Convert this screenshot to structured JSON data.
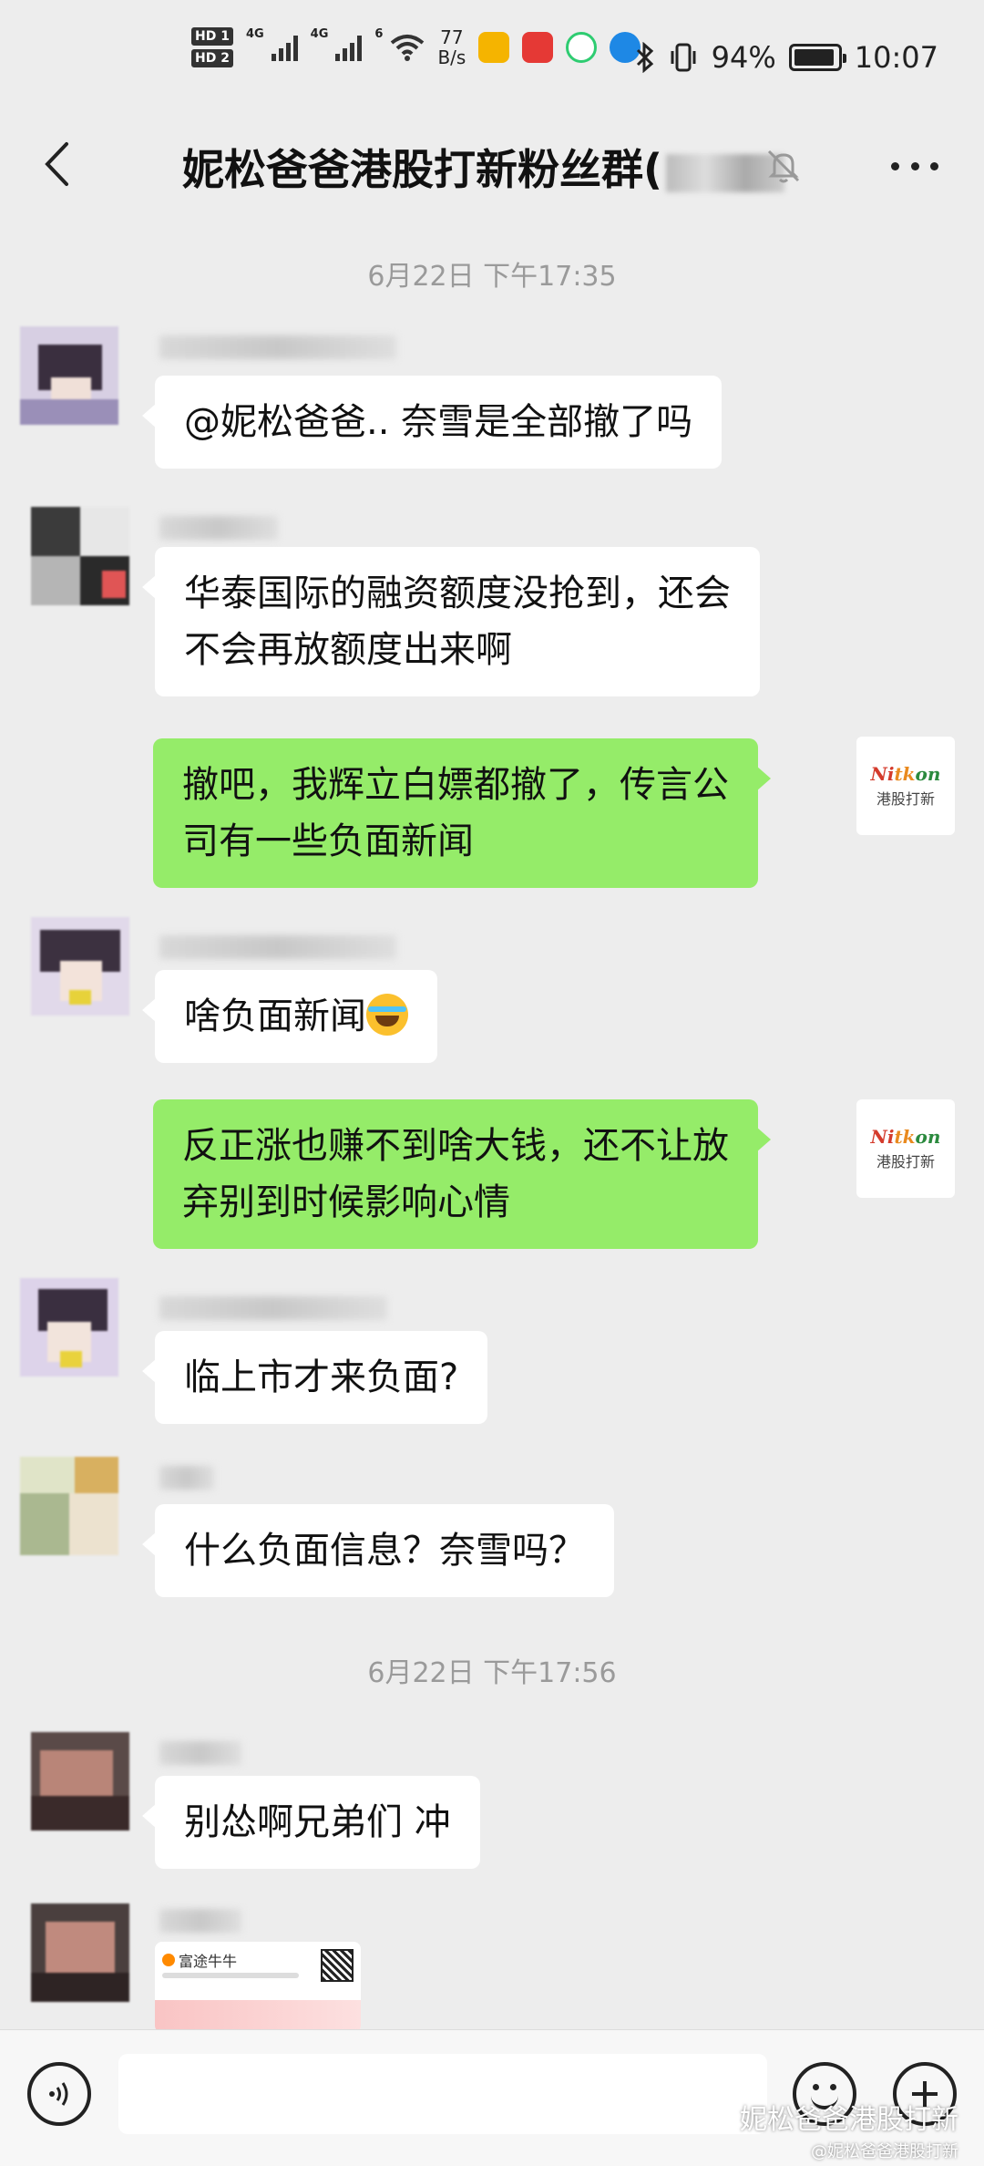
{
  "status_bar": {
    "hd1": "HD 1",
    "hd2": "HD 2",
    "net1": "4G",
    "net2": "4G",
    "wifi": "6",
    "speed_value": "77",
    "speed_unit": "B/s",
    "battery": "94%",
    "battery_level": 0.94,
    "time": "10:07"
  },
  "header": {
    "title": "妮松爸爸港股打新粉丝群("
  },
  "messages": [
    {
      "type": "timestamp",
      "text": "6月22日 下午17:35"
    },
    {
      "type": "incoming",
      "text": "@妮松爸爸.. 奈雪是全部撤了吗"
    },
    {
      "type": "incoming",
      "lines": [
        "华泰国际的融资额度没抢到，还会",
        "不会再放额度出来啊"
      ]
    },
    {
      "type": "outgoing",
      "lines": [
        "撤吧，我辉立白嫖都撤了，传言公",
        "司有一些负面新闻"
      ]
    },
    {
      "type": "incoming",
      "text": "啥负面新闻"
    },
    {
      "type": "outgoing",
      "lines": [
        "反正涨也赚不到啥大钱，还不让放",
        "弃别到时候影响心情"
      ]
    },
    {
      "type": "incoming",
      "text": "临上市才来负面?"
    },
    {
      "type": "incoming",
      "text": "什么负面信息？奈雪吗？"
    },
    {
      "type": "timestamp",
      "text": "6月22日 下午17:56"
    },
    {
      "type": "incoming",
      "text": "别怂啊兄弟们 冲"
    },
    {
      "type": "card",
      "brand": "富途牛牛"
    }
  ],
  "self_avatar": {
    "logo": [
      "Ni",
      "tk",
      "on"
    ],
    "sub": "港股打新"
  },
  "input_bar": {
    "placeholder": ""
  },
  "watermark": {
    "main": "妮松爸爸港股打新",
    "sub": "@妮松爸爸港股打新"
  },
  "icons": {
    "back": "chevron-left-icon",
    "mute": "bell-off-icon",
    "more": "more-horizontal-icon",
    "voice": "voice-icon",
    "emoji": "emoji-icon",
    "plus": "plus-icon"
  },
  "colors": {
    "background": "#ededed",
    "outgoing_bubble": "#95ec69",
    "incoming_bubble": "#ffffff"
  }
}
